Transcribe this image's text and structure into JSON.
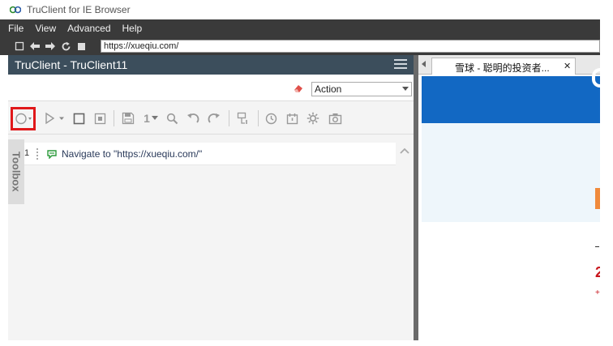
{
  "window": {
    "title": "TruClient for IE Browser"
  },
  "menu": {
    "items": [
      "File",
      "View",
      "Advanced",
      "Help"
    ]
  },
  "address": {
    "url": "https://xueqiu.com/"
  },
  "panel": {
    "title": "TruClient - TruClient11",
    "action_selected": "Action",
    "toolbar": {
      "replay_count": "1"
    },
    "toolbox_label": "Toolbox",
    "steps": [
      {
        "number": "1",
        "text": "Navigate to \"https://xueqiu.com/\""
      }
    ]
  },
  "browser": {
    "tab_title": "雪球 - 聪明的投资者...",
    "tab_close": "✕",
    "page_digit": "2",
    "page_plus": "+"
  },
  "colors": {
    "menubar": "#3a3a3a",
    "panel_header": "#3c4e5c",
    "record_highlight": "#e0181a",
    "banner_blue": "#1268c3",
    "accent_orange": "#f08a3c",
    "price_red": "#c8161d"
  }
}
